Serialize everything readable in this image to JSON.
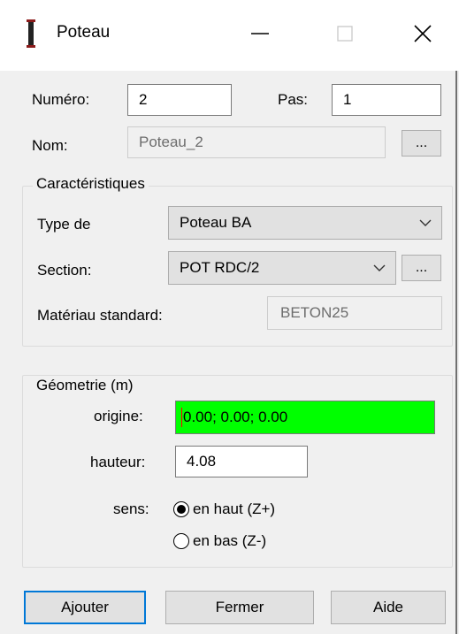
{
  "window": {
    "title": "Poteau"
  },
  "fields": {
    "numero_label": "Numéro:",
    "numero_value": "2",
    "pas_label": "Pas:",
    "pas_value": "1",
    "nom_label": "Nom:",
    "nom_value": "Poteau_2",
    "browse_label": "..."
  },
  "caracteristiques": {
    "title": "Caractéristiques",
    "type_label": "Type de",
    "type_value": "Poteau BA",
    "section_label": "Section:",
    "section_value": "POT RDC/2",
    "section_browse_label": "...",
    "materiau_label": "Matériau standard:",
    "materiau_value": "BETON25"
  },
  "geometrie": {
    "title": "Géometrie (m)",
    "origine_label": "origine:",
    "origine_value": "0.00; 0.00; 0.00",
    "origine_bg": "#00ff00",
    "hauteur_label": "hauteur:",
    "hauteur_value": "4.08",
    "sens_label": "sens:",
    "sens_options": [
      {
        "label": "en haut (Z+)",
        "selected": true
      },
      {
        "label": "en bas (Z-)",
        "selected": false
      }
    ]
  },
  "buttons": {
    "ajouter": "Ajouter",
    "fermer": "Fermer",
    "aide": "Aide"
  }
}
